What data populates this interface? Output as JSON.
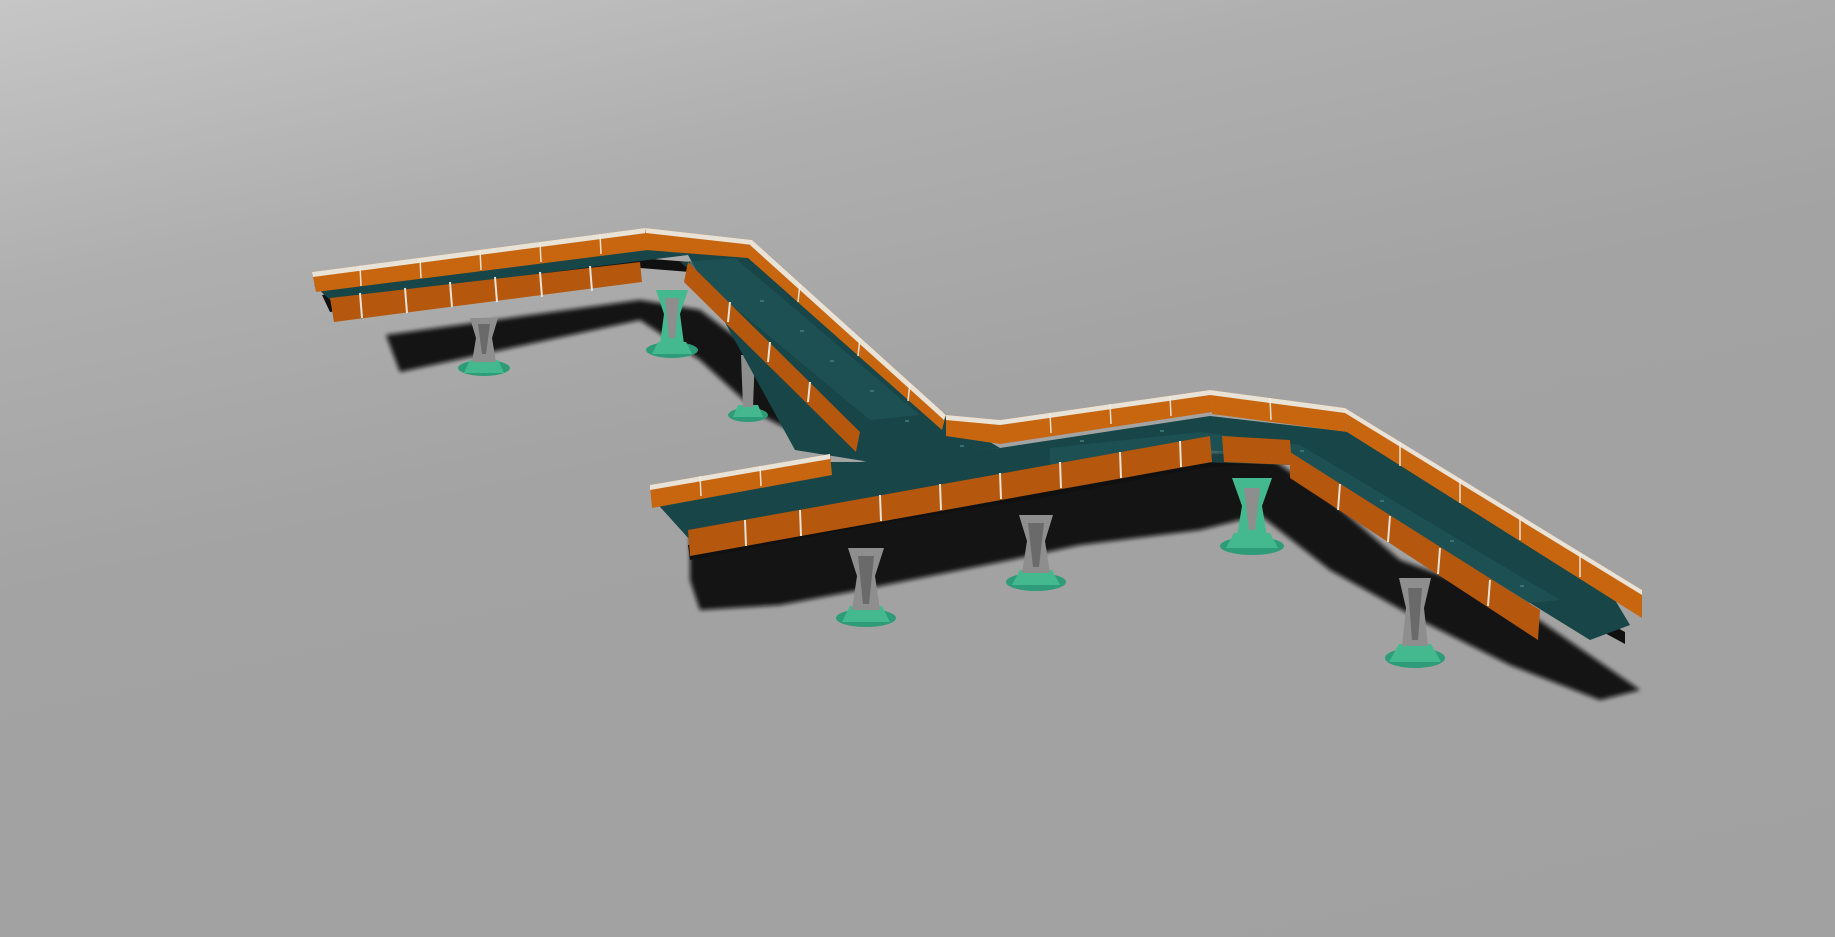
{
  "scene": {
    "subject": "walkway-bridge-3d-model",
    "background_top": "#c6c6c6",
    "background_bottom": "#a1a1a1",
    "deck_color": "#174548",
    "railing_color": "#c8660f",
    "railing_dark": "#9a4a0b",
    "railing_light": "#e9e2d6",
    "pier_color": "#8e8e8e",
    "pier_base_color": "#44b98f",
    "shadow_color": "#0a0a0a"
  }
}
